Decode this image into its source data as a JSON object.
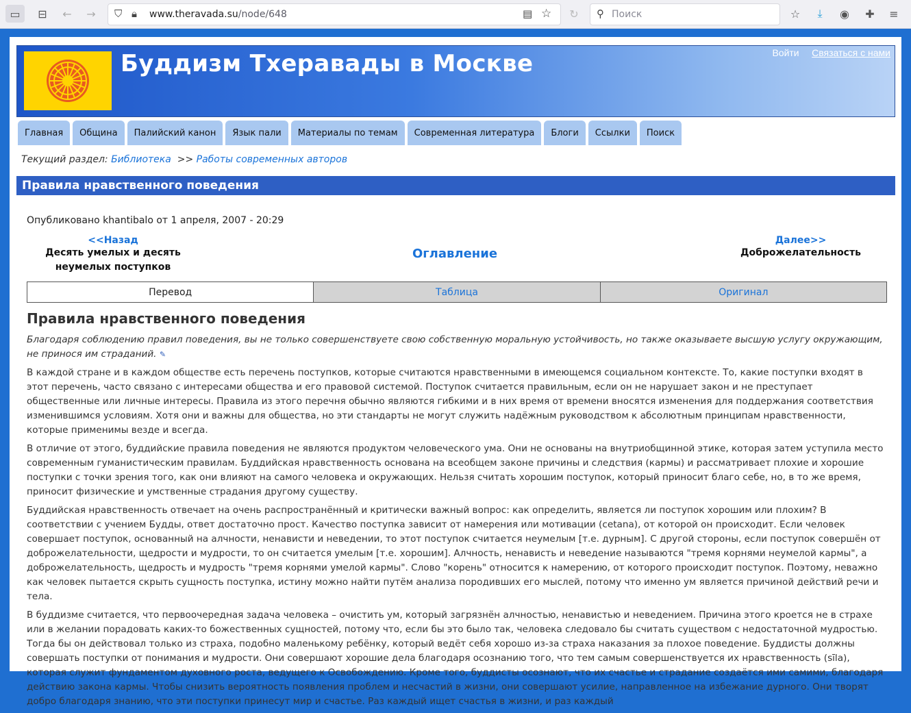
{
  "browser": {
    "url_host": "www.theravada.su",
    "url_path": "/node/648",
    "search_placeholder": "Поиск"
  },
  "site": {
    "title": "Буддизм Тхеравады в Москве",
    "login": "Войти",
    "contact": "Связаться с нами"
  },
  "nav": [
    "Главная",
    "Община",
    "Палийский канон",
    "Язык пали",
    "Материалы по темам",
    "Современная литература",
    "Блоги",
    "Ссылки",
    "Поиск"
  ],
  "breadcrumb": {
    "prefix": "Текущий раздел:",
    "item1": "Библиотека",
    "sep": ">>",
    "item2": "Работы современных авторов"
  },
  "page": {
    "title": "Правила нравственного поведения",
    "meta": "Опубликовано khantibalo от 1 апреля, 2007 - 20:29",
    "prev_link": "<<Назад",
    "prev_title": "Десять умелых и десять неумелых поступков",
    "toc": "Оглавление",
    "next_link": "Далее>>",
    "next_title": "Доброжелательность",
    "tabs": [
      "Перевод",
      "Таблица",
      "Оригинал"
    ]
  },
  "article": {
    "heading": "Правила нравственного поведения",
    "lead": "Благодаря соблюдению правил поведения, вы не только совершенствуете свою собственную моральную устойчивость, но также оказываете высшую услугу окружающим, не принося им страданий.",
    "paragraphs": [
      "В каждой стране и в каждом обществе есть перечень поступков, которые считаются нравственными в имеющемся социальном контексте. То, какие поступки входят в этот перечень, часто связано с интересами общества и его правовой системой. Поступок считается правильным, если он не нарушает закон и не преступает общественные или личные интересы. Правила из этого перечня обычно являются гибкими и в них время от времени вносятся изменения для поддержания соответствия изменившимся условиям. Хотя они и важны для общества, но эти стандарты не могут служить надёжным руководством к абсолютным принципам нравственности, которые применимы везде и всегда.",
      "В отличие от этого, буддийские правила поведения не являются продуктом человеческого ума. Они не основаны на внутриобщинной этике, которая затем уступила место современным гуманистическим правилам. Буддийская нравственность основана на всеобщем законе причины и следствия (кармы) и рассматривает плохие и хорошие поступки с точки зрения того, как они влияют на самого человека и окружающих. Нельзя считать хорошим поступок, который приносит благо себе, но, в то же время, приносит физические и умственные страдания другому существу.",
      "Буддийская нравственность отвечает на очень распространённый и критически важный вопрос: как определить, является ли поступок хорошим или плохим? В соответствии с учением Будды, ответ достаточно прост. Качество поступка зависит от намерения или мотивации (cetana), от которой он происходит. Если человек совершает поступок, основанный на алчности, ненависти и неведении, то этот поступок считается неумелым [т.е. дурным]. С другой стороны, если поступок совершён от доброжелательности, щедрости и мудрости, то он считается умелым [т.е. хорошим]. Алчность, ненависть и неведение называются \"тремя корнями неумелой кармы\", а доброжелательность, щедрость и мудрость \"тремя корнями умелой кармы\". Слово \"корень\" относится к намерению, от которого происходит поступок. Поэтому, неважно как человек пытается скрыть сущность поступка, истину можно найти путём анализа породивших его мыслей, потому что именно ум является причиной действий речи и тела.",
      "В буддизме считается, что первоочередная задача человека – очистить ум, который загрязнён алчностью, ненавистью и неведением. Причина этого кроется не в страхе или в желании порадовать каких-то божественных сущностей, потому что, если бы это было так, человека следовало бы считать существом с недостаточной мудростью. Тогда бы он действовал только из страха, подобно маленькому ребёнку, который ведёт себя хорошо из-за страха наказания за плохое поведение. Буддисты должны совершать поступки от понимания и мудрости. Они совершают хорошие дела благодаря осознанию того, что тем самым совершенствуется их нравственность (sīla), которая служит фундаментом духовного роста, ведущего к Освобождению. Кроме того, буддисты осознают, что их счастье и страдание создаётся ими самими, благодаря действию закона кармы. Чтобы снизить вероятность появления проблем и несчастий в жизни, они совершают усилие, направленное на избежание дурного. Они творят добро благодаря знанию, что эти поступки принесут мир и счастье. Раз каждый ищет счастья в жизни, и раз каждый"
    ]
  }
}
